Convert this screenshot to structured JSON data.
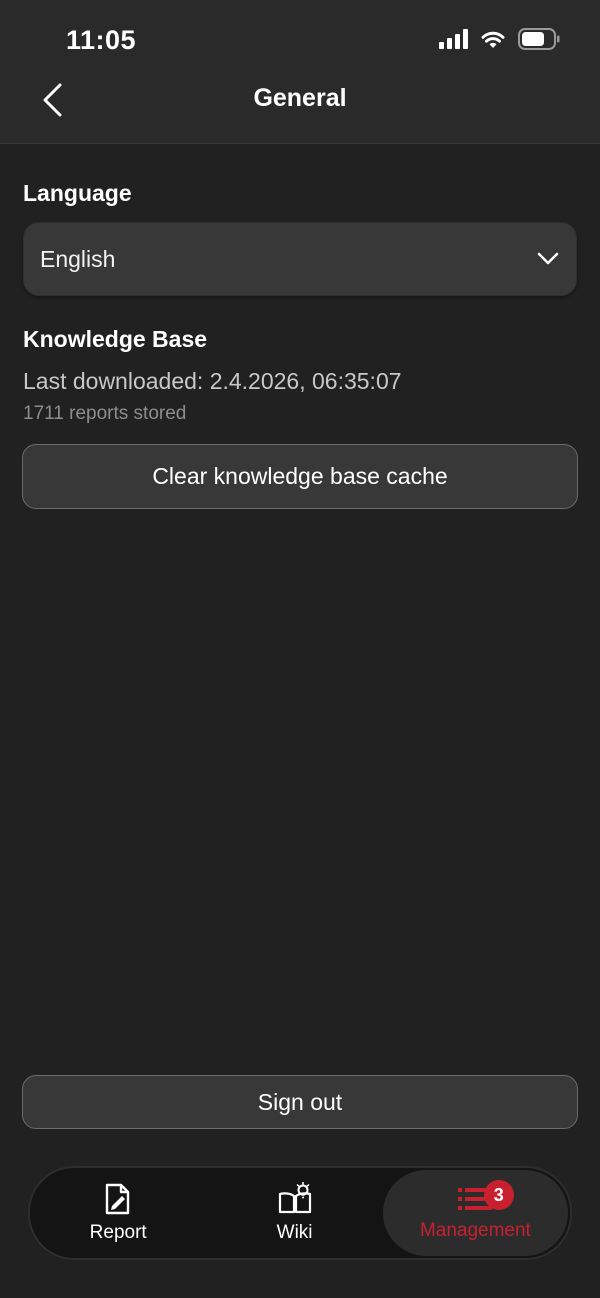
{
  "status_bar": {
    "time": "11:05"
  },
  "nav": {
    "title": "General",
    "back_icon": "chevron-left-icon"
  },
  "language": {
    "heading": "Language",
    "selected": "English",
    "dropdown_icon": "chevron-down-icon"
  },
  "knowledge_base": {
    "heading": "Knowledge Base",
    "last_downloaded": "Last downloaded: 2.4.2026, 06:35:07",
    "reports_stored": "1711 reports stored",
    "clear_button_label": "Clear knowledge base cache"
  },
  "sign_out_label": "Sign out",
  "tab_bar": {
    "tabs": [
      {
        "label": "Report",
        "icon": "report-edit-icon",
        "active": false
      },
      {
        "label": "Wiki",
        "icon": "wiki-book-icon",
        "active": false
      },
      {
        "label": "Management",
        "icon": "management-list-icon",
        "active": true,
        "badge": "3"
      }
    ]
  },
  "colors": {
    "background": "#212121",
    "accent": "#c8202f",
    "button_bg": "#383838"
  }
}
